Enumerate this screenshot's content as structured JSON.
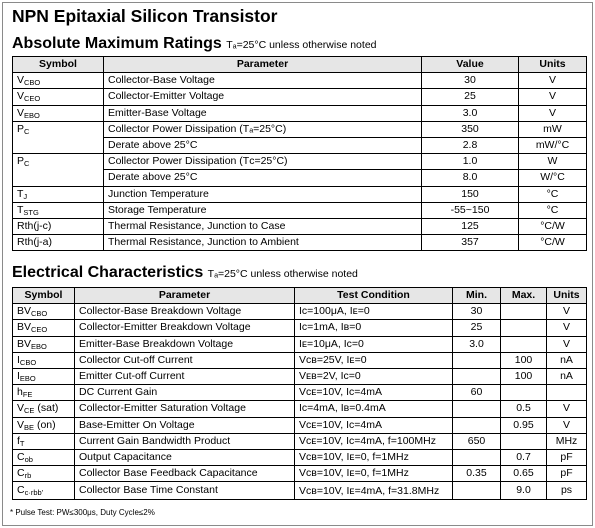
{
  "title": "NPN Epitaxial Silicon Transistor",
  "abs": {
    "heading": "Absolute Maximum Ratings",
    "condition": "Tₐ=25°C unless otherwise noted",
    "headers": [
      "Symbol",
      "Parameter",
      "Value",
      "Units"
    ],
    "rows": [
      {
        "sym": "V",
        "sub": "CBO",
        "param": "Collector-Base Voltage",
        "value": "30",
        "unit": "V"
      },
      {
        "sym": "V",
        "sub": "CEO",
        "param": "Collector-Emitter Voltage",
        "value": "25",
        "unit": "V"
      },
      {
        "sym": "V",
        "sub": "EBO",
        "param": "Emitter-Base Voltage",
        "value": "3.0",
        "unit": "V"
      },
      {
        "sym": "P",
        "sub": "C",
        "param": "Collector Power Dissipation (Tₐ=25°C)",
        "value": "350",
        "unit": "mW"
      },
      {
        "sym": "",
        "sub": "",
        "param": "Derate above 25°C",
        "value": "2.8",
        "unit": "mW/°C"
      },
      {
        "sym": "P",
        "sub": "C",
        "param": "Collector Power Dissipation (Tᴄ=25°C)",
        "value": "1.0",
        "unit": "W"
      },
      {
        "sym": "",
        "sub": "",
        "param": "Derate above 25°C",
        "value": "8.0",
        "unit": "W/°C"
      },
      {
        "sym": "T",
        "sub": "J",
        "param": "Junction Temperature",
        "value": "150",
        "unit": "°C"
      },
      {
        "sym": "T",
        "sub": "STG",
        "param": "Storage Temperature",
        "value": "-55~150",
        "unit": "°C"
      },
      {
        "sym": "Rth(j-c)",
        "sub": "",
        "param": "Thermal Resistance, Junction to Case",
        "value": "125",
        "unit": "°C/W"
      },
      {
        "sym": "Rth(j-a)",
        "sub": "",
        "param": "Thermal Resistance, Junction to Ambient",
        "value": "357",
        "unit": "°C/W"
      }
    ]
  },
  "elec": {
    "heading": "Electrical Characteristics",
    "condition": "Tₐ=25°C unless otherwise noted",
    "headers": [
      "Symbol",
      "Parameter",
      "Test Condition",
      "Min.",
      "Max.",
      "Units"
    ],
    "rows": [
      {
        "sym": "BV",
        "sub": "CBO",
        "param": "Collector-Base Breakdown Voltage",
        "cond": "Iᴄ=100μA, Iᴇ=0",
        "min": "30",
        "max": "",
        "unit": "V"
      },
      {
        "sym": "BV",
        "sub": "CEO",
        "param": "Collector-Emitter Breakdown Voltage",
        "cond": "Iᴄ=1mA, Iʙ=0",
        "min": "25",
        "max": "",
        "unit": "V"
      },
      {
        "sym": "BV",
        "sub": "EBO",
        "param": "Emitter-Base Breakdown Voltage",
        "cond": "Iᴇ=10μA, Iᴄ=0",
        "min": "3.0",
        "max": "",
        "unit": "V"
      },
      {
        "sym": "I",
        "sub": "CBO",
        "param": "Collector Cut-off Current",
        "cond": "Vᴄʙ=25V, Iᴇ=0",
        "min": "",
        "max": "100",
        "unit": "nA"
      },
      {
        "sym": "I",
        "sub": "EBO",
        "param": "Emitter Cut-off Current",
        "cond": "Vᴇʙ=2V, Iᴄ=0",
        "min": "",
        "max": "100",
        "unit": "nA"
      },
      {
        "sym": "h",
        "sub": "FE",
        "param": "DC Current Gain",
        "cond": "Vᴄᴇ=10V, Iᴄ=4mA",
        "min": "60",
        "max": "",
        "unit": ""
      },
      {
        "sym": "V",
        "sub": "CE",
        "sym_suffix": " (sat)",
        "param": "Collector-Emitter Saturation Voltage",
        "cond": "Iᴄ=4mA, Iʙ=0.4mA",
        "min": "",
        "max": "0.5",
        "unit": "V"
      },
      {
        "sym": "V",
        "sub": "BE",
        "sym_suffix": " (on)",
        "param": "Base-Emitter On Voltage",
        "cond": "Vᴄᴇ=10V, Iᴄ=4mA",
        "min": "",
        "max": "0.95",
        "unit": "V"
      },
      {
        "sym": "f",
        "sub": "T",
        "param": "Current Gain Bandwidth Product",
        "cond": "Vᴄᴇ=10V, Iᴄ=4mA, f=100MHz",
        "min": "650",
        "max": "",
        "unit": "MHz"
      },
      {
        "sym": "C",
        "sub": "ob",
        "param": "Output Capacitance",
        "cond": "Vᴄʙ=10V, Iᴇ=0, f=1MHz",
        "min": "",
        "max": "0.7",
        "unit": "pF"
      },
      {
        "sym": "C",
        "sub": "rb",
        "param": "Collector Base Feedback Capacitance",
        "cond": "Vᴄʙ=10V, Iᴇ=0, f=1MHz",
        "min": "0.35",
        "max": "0.65",
        "unit": "pF"
      },
      {
        "sym": "C",
        "sub": "c·rbb'",
        "param": "Collector Base Time Constant",
        "cond": "Vᴄʙ=10V, Iᴇ=4mA, f=31.8MHz",
        "min": "",
        "max": "9.0",
        "unit": "ps"
      }
    ]
  },
  "footnote": "* Pulse Test: PW≤300μs, Duty Cycle≤2%"
}
